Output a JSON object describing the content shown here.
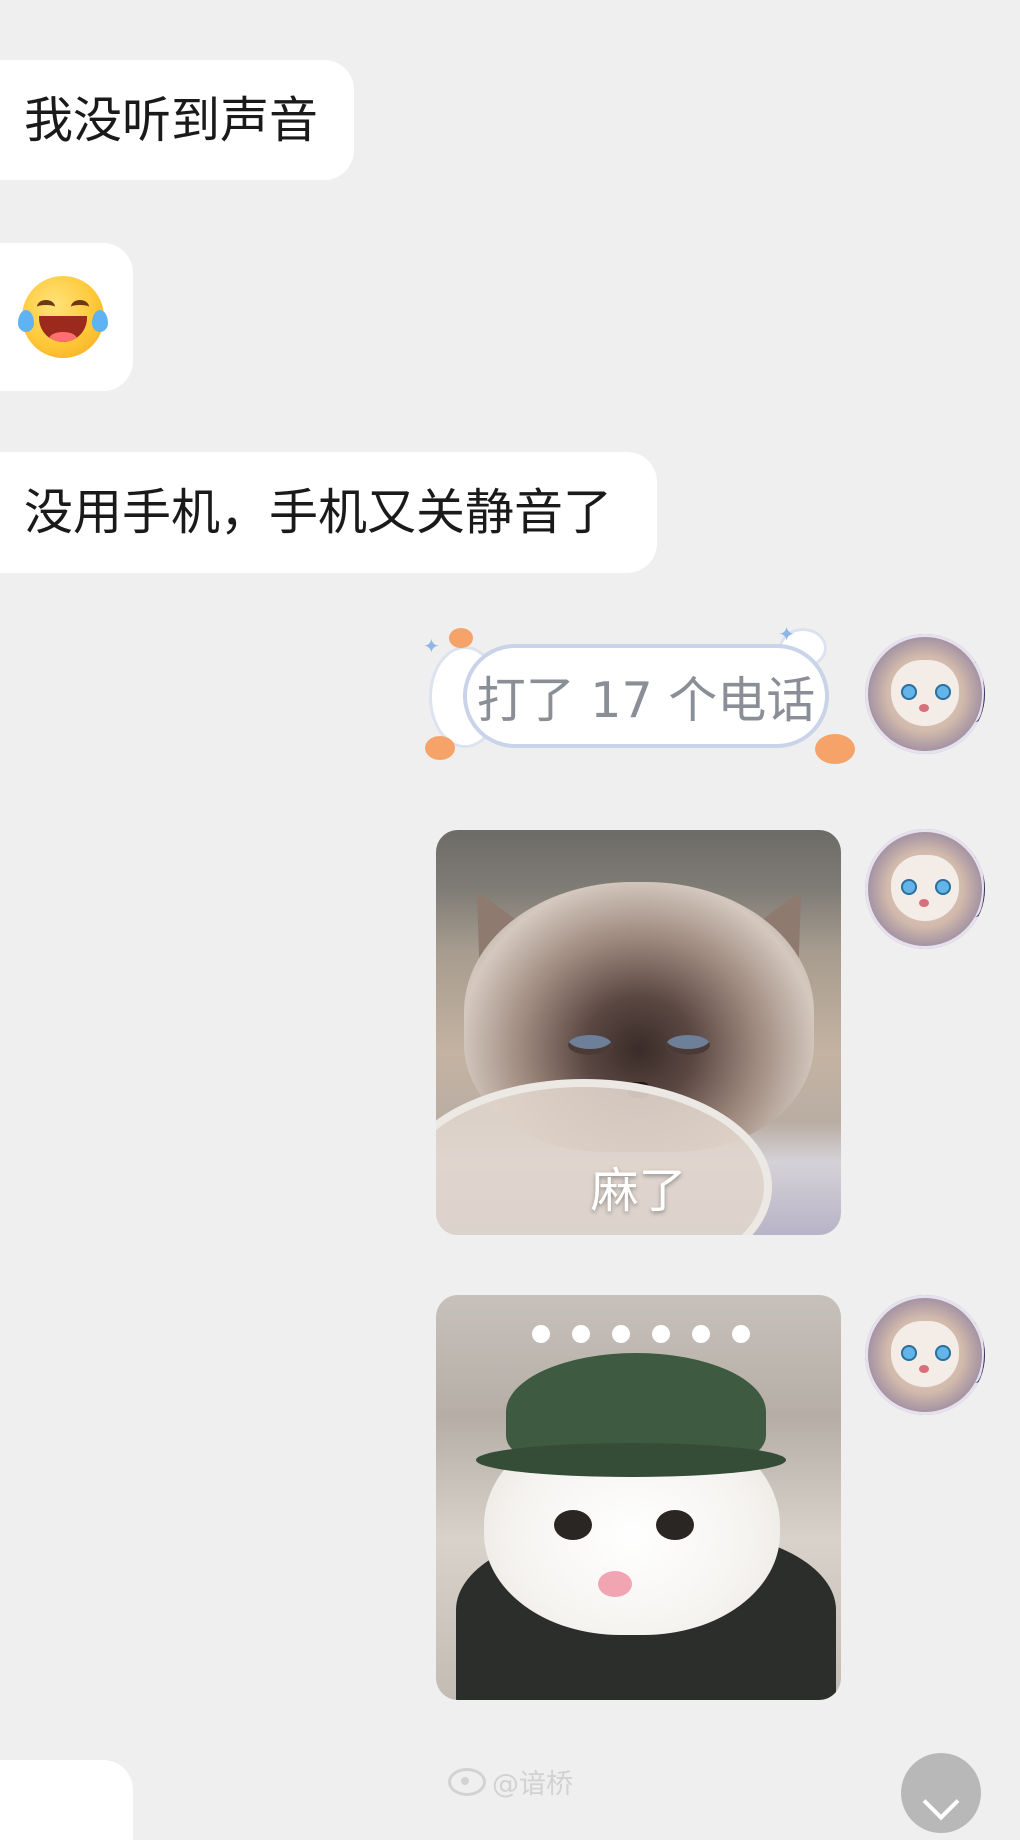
{
  "messages": {
    "m1": "我没听到声音",
    "m3": "没用手机，手机又关静音了",
    "sticker_text": "打了 17 个电话",
    "image1_caption": "麻了"
  },
  "watermark": {
    "text": "@谙桥"
  },
  "icons": {
    "emoji": "laughing-tears-emoji",
    "watermark": "weibo-icon",
    "scroll": "chevron-down-icon"
  },
  "colors": {
    "background": "#efefef",
    "bubble": "#ffffff",
    "text": "#1a1a1a",
    "sticker_text": "#8a8e96",
    "scroll_button": "#b8b8b8"
  }
}
